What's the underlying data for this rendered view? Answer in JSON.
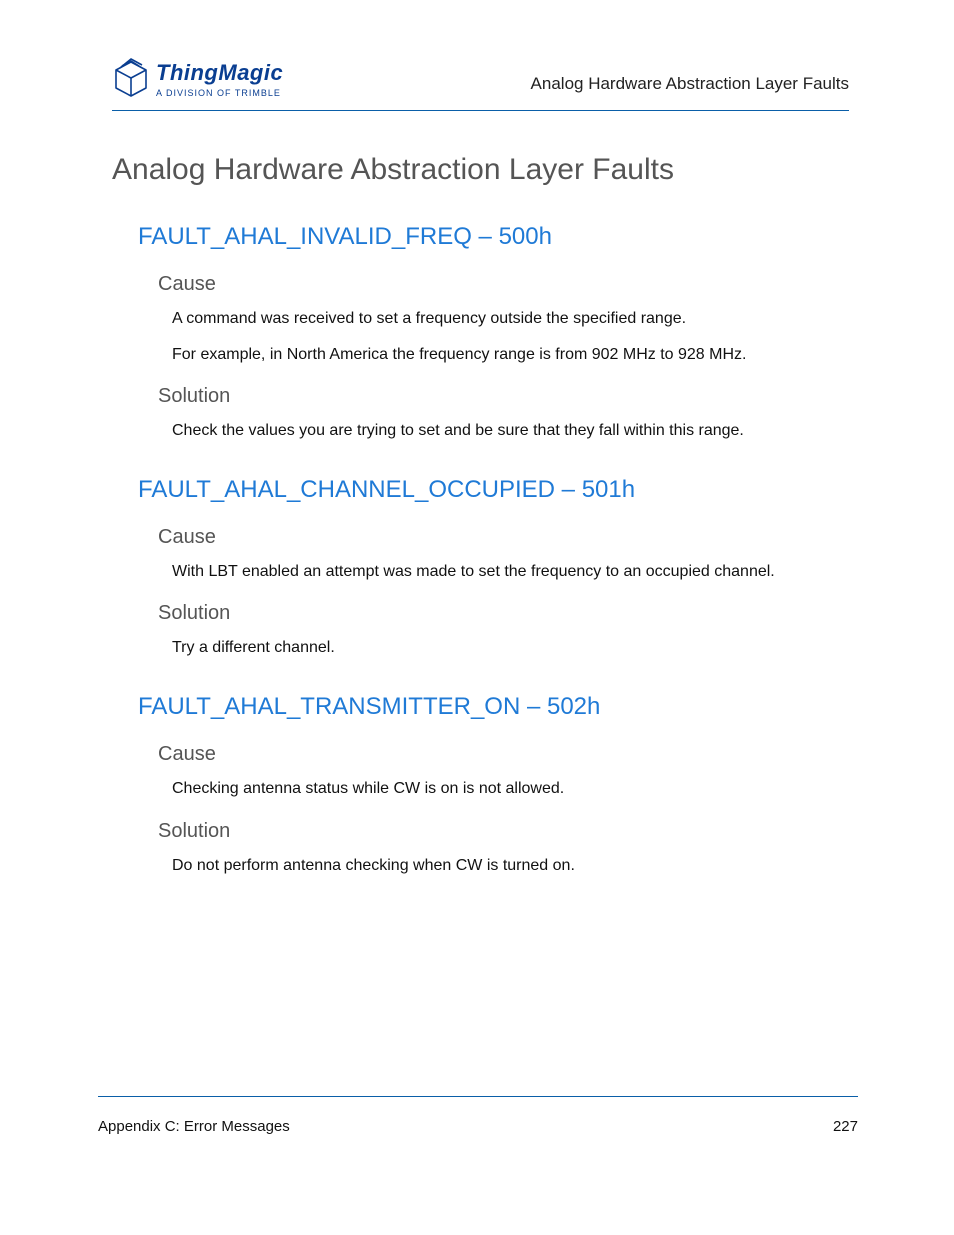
{
  "header": {
    "logo_name": "ThingMagic",
    "logo_sub": "A DIVISION OF TRIMBLE",
    "running_title": "Analog Hardware Abstraction Layer Faults"
  },
  "title": "Analog Hardware Abstraction Layer Faults",
  "faults": [
    {
      "heading": "FAULT_AHAL_INVALID_FREQ – 500h",
      "cause_label": "Cause",
      "cause_paras": [
        "A command was received to set a frequency outside the specified range.",
        "For example, in North America the frequency range is from 902 MHz to 928 MHz."
      ],
      "solution_label": "Solution",
      "solution_paras": [
        "Check the values you are trying to set and be sure that they fall within this range."
      ]
    },
    {
      "heading": "FAULT_AHAL_CHANNEL_OCCUPIED – 501h",
      "cause_label": "Cause",
      "cause_paras": [
        "With LBT enabled an attempt was made to set the frequency to an occupied channel."
      ],
      "solution_label": "Solution",
      "solution_paras": [
        "Try a different channel."
      ]
    },
    {
      "heading": "FAULT_AHAL_TRANSMITTER_ON – 502h",
      "cause_label": "Cause",
      "cause_paras": [
        "Checking antenna status while CW is on is not allowed."
      ],
      "solution_label": "Solution",
      "solution_paras": [
        "Do not perform antenna checking when CW is turned on."
      ]
    }
  ],
  "footer": {
    "left": "Appendix C: Error Messages",
    "right": "227"
  }
}
